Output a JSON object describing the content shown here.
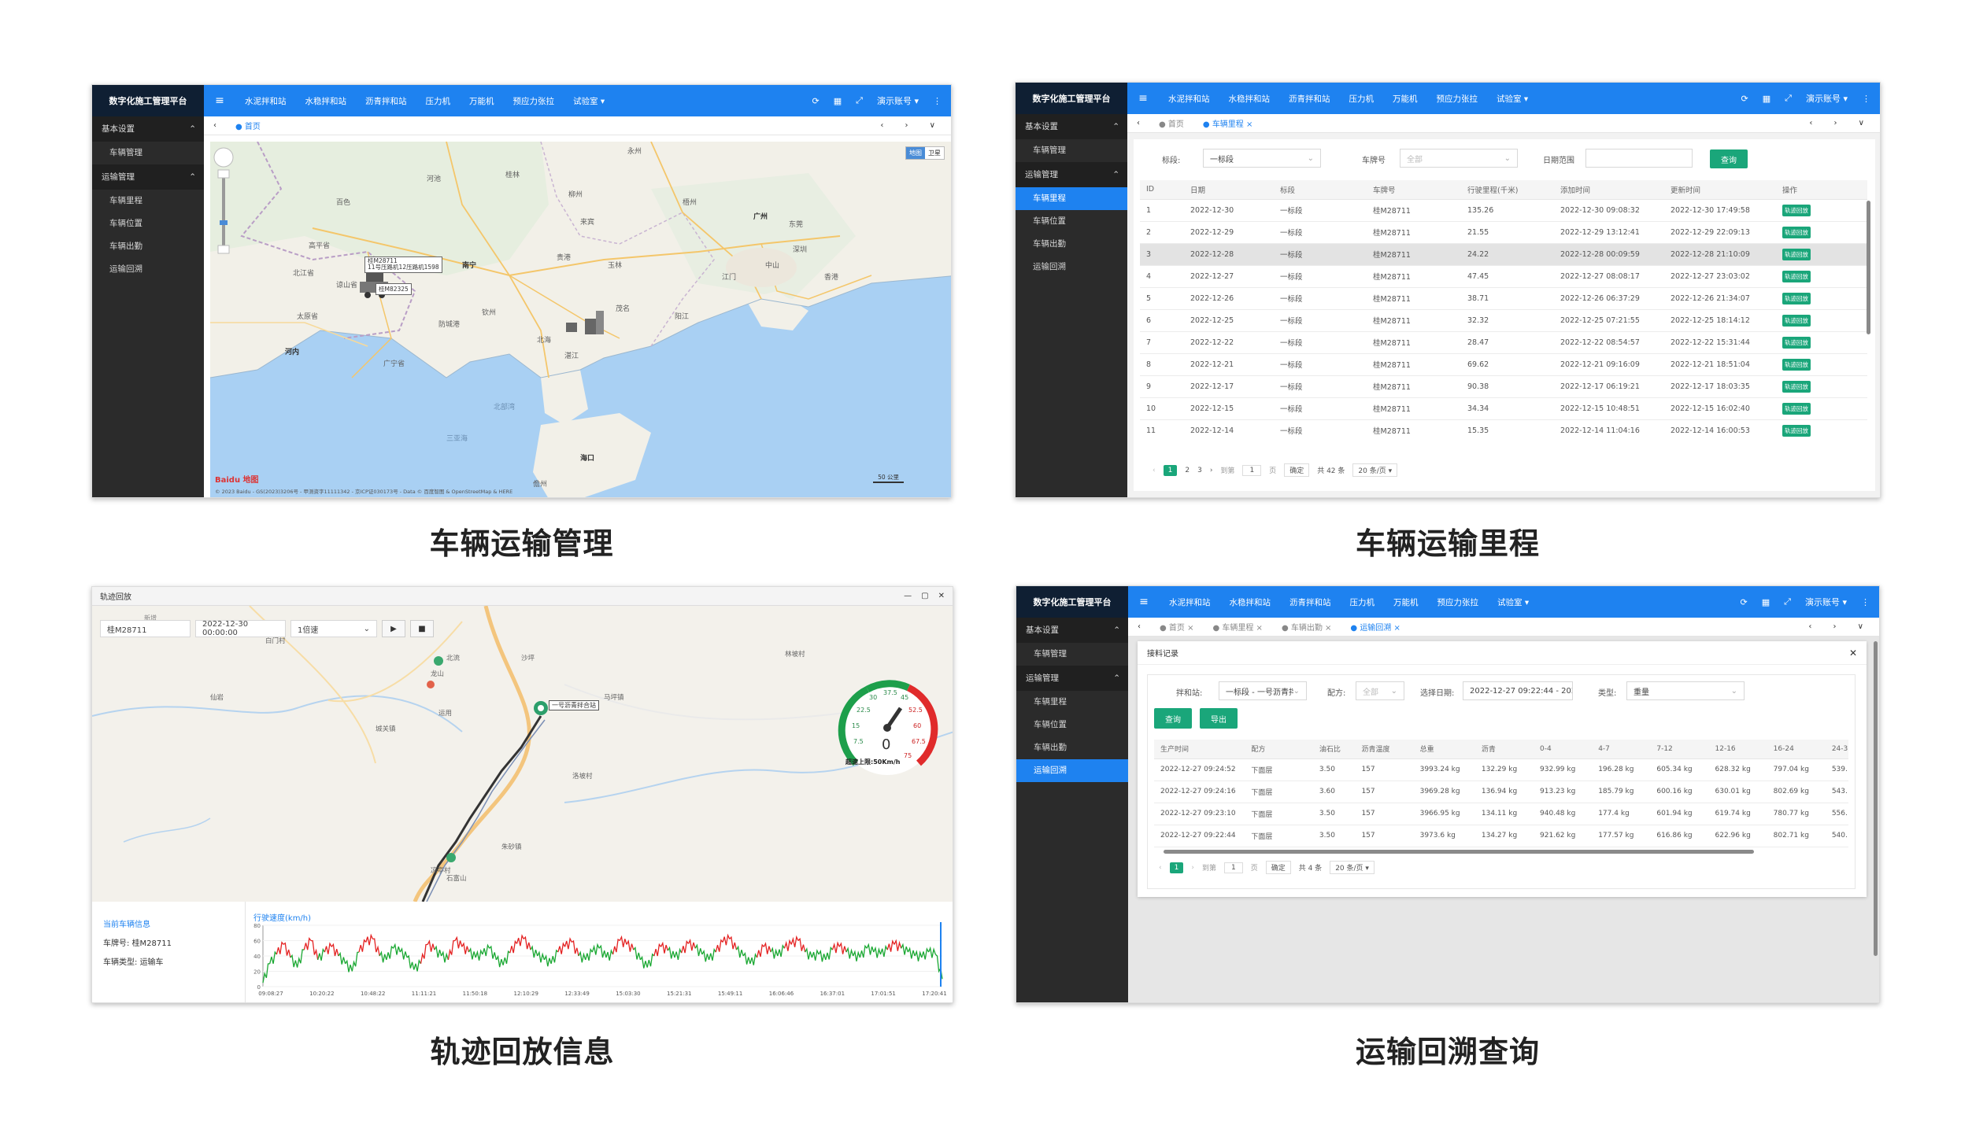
{
  "captions": [
    "车辆运输管理",
    "车辆运输里程",
    "轨迹回放信息",
    "运输回溯查询"
  ],
  "app": {
    "brand": "数字化施工管理平台",
    "menu_icon": "≡",
    "nav": [
      "水泥拌和站",
      "水稳拌和站",
      "沥青拌和站",
      "压力机",
      "万能机",
      "预应力张拉"
    ],
    "nav_dropdown": "试验室 ▾",
    "icons": [
      "⟳",
      "▦",
      "⤢"
    ],
    "user": "演示账号 ▾",
    "more": "⋮",
    "sidebar": {
      "group1": "基本设置",
      "group1_items": [
        "车辆管理"
      ],
      "group2": "运输管理",
      "group2_items": [
        "车辆里程",
        "车辆位置",
        "车辆出勤",
        "运输回溯"
      ]
    },
    "tab_home": "首页",
    "tab_arrows": "‹ › ∨"
  },
  "panel1": {
    "map_toggle": [
      "地图",
      "卫星"
    ],
    "place_labels": [
      "桂林",
      "梧州",
      "广州",
      "东莞",
      "深圳",
      "香港",
      "南宁",
      "钦州",
      "北海",
      "湛江",
      "茂名",
      "阳江",
      "中山",
      "江门",
      "崇左",
      "百色",
      "河池",
      "海口",
      "儋州",
      "防城港",
      "玉林",
      "贵港",
      "北部湾",
      "三亚海",
      "河内",
      "太原省",
      "谅山省",
      "北江省",
      "高平省",
      "广宁省",
      "永州",
      "来宾",
      "柳州"
    ],
    "vehicle_label1": "桂M28711\n11号压路机​12压路机1598",
    "vehicle_label2": "桂M82325",
    "copyright": "© 2023 Baidu - GS(2023)3206号 - 甲测资字11111342 - 京ICP证030173号 - Data © 百度智图 & OpenStreetMap & HERE",
    "scale": "50 公里",
    "logo": "Baidu 地图"
  },
  "panel2": {
    "filters": {
      "section_label": "标段:",
      "section_value": "一标段",
      "plate_label": "车牌号",
      "plate_value": "全部",
      "date_label": "日期范围",
      "query": "查询"
    },
    "columns": [
      "ID",
      "日期",
      "标段",
      "车牌号",
      "行驶里程(千米)",
      "添加时间",
      "更新时间",
      "操作"
    ],
    "rows": [
      [
        "1",
        "2022-12-30",
        "一标段",
        "桂M28711",
        "135.26",
        "2022-12-30 09:08:32",
        "2022-12-30 17:49:58",
        "轨迹回放"
      ],
      [
        "2",
        "2022-12-29",
        "一标段",
        "桂M28711",
        "21.55",
        "2022-12-29 13:12:41",
        "2022-12-29 22:09:13",
        "轨迹回放"
      ],
      [
        "3",
        "2022-12-28",
        "一标段",
        "桂M28711",
        "24.22",
        "2022-12-28 00:09:59",
        "2022-12-28 21:10:09",
        "轨迹回放"
      ],
      [
        "4",
        "2022-12-27",
        "一标段",
        "桂M28711",
        "47.45",
        "2022-12-27 08:08:17",
        "2022-12-27 23:03:02",
        "轨迹回放"
      ],
      [
        "5",
        "2022-12-26",
        "一标段",
        "桂M28711",
        "38.71",
        "2022-12-26 06:37:29",
        "2022-12-26 21:34:07",
        "轨迹回放"
      ],
      [
        "6",
        "2022-12-25",
        "一标段",
        "桂M28711",
        "32.32",
        "2022-12-25 07:21:55",
        "2022-12-25 18:14:12",
        "轨迹回放"
      ],
      [
        "7",
        "2022-12-22",
        "一标段",
        "桂M28711",
        "28.47",
        "2022-12-22 08:54:57",
        "2022-12-22 15:31:44",
        "轨迹回放"
      ],
      [
        "8",
        "2022-12-21",
        "一标段",
        "桂M28711",
        "69.62",
        "2022-12-21 09:16:09",
        "2022-12-21 18:51:04",
        "轨迹回放"
      ],
      [
        "9",
        "2022-12-17",
        "一标段",
        "桂M28711",
        "90.38",
        "2022-12-17 06:19:21",
        "2022-12-17 18:03:35",
        "轨迹回放"
      ],
      [
        "10",
        "2022-12-15",
        "一标段",
        "桂M28711",
        "34.34",
        "2022-12-15 10:48:51",
        "2022-12-15 16:02:40",
        "轨迹回放"
      ],
      [
        "11",
        "2022-12-14",
        "一标段",
        "桂M28711",
        "15.35",
        "2022-12-14 11:04:16",
        "2022-12-14 16:00:53",
        "轨迹回放"
      ]
    ],
    "pager": {
      "prev": "‹",
      "pages": [
        "1",
        "2",
        "3"
      ],
      "next": "›",
      "goto": "到第",
      "goto_value": "1",
      "page_unit": "页",
      "confirm": "确定",
      "total": "共 42 条",
      "size": "20 条/页 ▾"
    }
  },
  "panel3": {
    "title": "轨迹回放",
    "window_icons": [
      "—",
      "▢",
      "✕"
    ],
    "new_label": "新增",
    "plate": "桂M28711",
    "start_time": "2022-12-30 00:00:00",
    "speed_select": "1倍速",
    "play": "▶",
    "stop": "■",
    "map_labels": [
      "白门村",
      "龙山",
      "运用",
      "北流",
      "城关镇",
      "沙坪",
      "林坡村",
      "凉亭村",
      "石富山",
      "洛坡村",
      "马坪镇",
      "仙岩",
      "朱砂镇"
    ],
    "station_label": "一号沥青拌合站",
    "gauge": {
      "ticks": [
        "7.5",
        "15",
        "22.5",
        "30",
        "37.5",
        "45",
        "52.5",
        "60",
        "67.5",
        "75"
      ],
      "value": "0",
      "limit": "超速上限:50Km/h"
    },
    "info": {
      "title": "当前车辆信息",
      "plate_label": "车牌号:",
      "plate_value": "桂M28711",
      "type_label": "车辆类型:",
      "type_value": "运输车"
    },
    "chart_title": "行驶速度(km/h)"
  },
  "panel4": {
    "tabs": [
      "首页",
      "车辆里程",
      "车辆出勤",
      "运输回溯"
    ],
    "modal_title": "接料记录",
    "close": "✕",
    "filters": {
      "mixer_label": "拌和站:",
      "mixer_value": "一标段 - 一号沥青拌",
      "recipe_label": "配方:",
      "recipe_value": "全部",
      "date_label": "选择日期:",
      "date_value": "2022-12-27 09:22:44 - 2022-",
      "type_label": "类型:",
      "type_value": "重量"
    },
    "query": "查询",
    "export": "导出",
    "columns": [
      "生产时间",
      "配方",
      "油石比",
      "沥青温度",
      "总重",
      "沥青",
      "0-4",
      "4-7",
      "7-12",
      "12-16",
      "16-24",
      "24-3"
    ],
    "rows": [
      [
        "2022-12-27 09:24:52",
        "下面层",
        "3.50",
        "157",
        "3993.24 kg",
        "132.29 kg",
        "932.99 kg",
        "196.28 kg",
        "605.34 kg",
        "628.32 kg",
        "797.04 kg",
        "539."
      ],
      [
        "2022-12-27 09:24:16",
        "下面层",
        "3.60",
        "157",
        "3969.28 kg",
        "136.94 kg",
        "913.23 kg",
        "185.79 kg",
        "600.16 kg",
        "630.01 kg",
        "802.69 kg",
        "543."
      ],
      [
        "2022-12-27 09:23:10",
        "下面层",
        "3.50",
        "157",
        "3966.95 kg",
        "134.11 kg",
        "940.48 kg",
        "177.4 kg",
        "601.94 kg",
        "619.74 kg",
        "780.77 kg",
        "556."
      ],
      [
        "2022-12-27 09:22:44",
        "下面层",
        "3.50",
        "157",
        "3973.6 kg",
        "134.27 kg",
        "921.62 kg",
        "177.57 kg",
        "616.86 kg",
        "622.96 kg",
        "802.71 kg",
        "540."
      ]
    ],
    "pager": {
      "prev": "‹",
      "page": "1",
      "next": "›",
      "goto": "到第",
      "goto_value": "1",
      "page_unit": "页",
      "confirm": "确定",
      "total": "共 4 条",
      "size": "20 条/页 ▾"
    }
  },
  "chart_data": {
    "type": "line",
    "title": "行驶速度(km/h)",
    "xlabel": "",
    "ylabel": "",
    "ylim": [
      0,
      80
    ],
    "yticks": [
      0,
      20,
      40,
      60,
      80
    ],
    "x_ticks": [
      "09:08:27",
      "10:20:22",
      "10:48:22",
      "11:11:21",
      "11:50:18",
      "12:10:29",
      "12:33:49",
      "15:03:30",
      "15:21:31",
      "15:49:11",
      "16:06:46",
      "16:37:01",
      "17:01:51",
      "17:20:41"
    ],
    "overspeed_limit": 50,
    "series": [
      {
        "values": [
          5,
          30,
          42,
          55,
          38,
          25,
          48,
          60,
          35,
          45,
          52,
          40,
          30,
          20,
          45,
          58,
          62,
          40,
          35,
          50,
          45,
          38,
          22,
          30,
          55,
          48,
          40,
          35,
          60,
          52,
          45,
          38,
          42,
          50,
          35,
          28,
          44,
          56,
          62,
          48,
          40,
          35,
          30,
          45,
          52,
          58,
          40,
          35,
          45,
          50,
          38,
          42,
          60,
          55,
          48,
          35,
          25,
          40,
          52,
          47,
          38,
          44,
          56,
          50,
          42,
          35,
          45,
          58,
          62,
          48,
          40,
          30,
          38,
          52,
          45,
          40,
          50,
          55,
          60,
          45,
          38,
          42,
          35,
          48,
          52,
          45,
          40,
          38,
          50,
          45,
          42,
          48,
          55,
          50,
          45,
          40,
          38,
          45,
          42,
          10
        ]
      }
    ]
  }
}
